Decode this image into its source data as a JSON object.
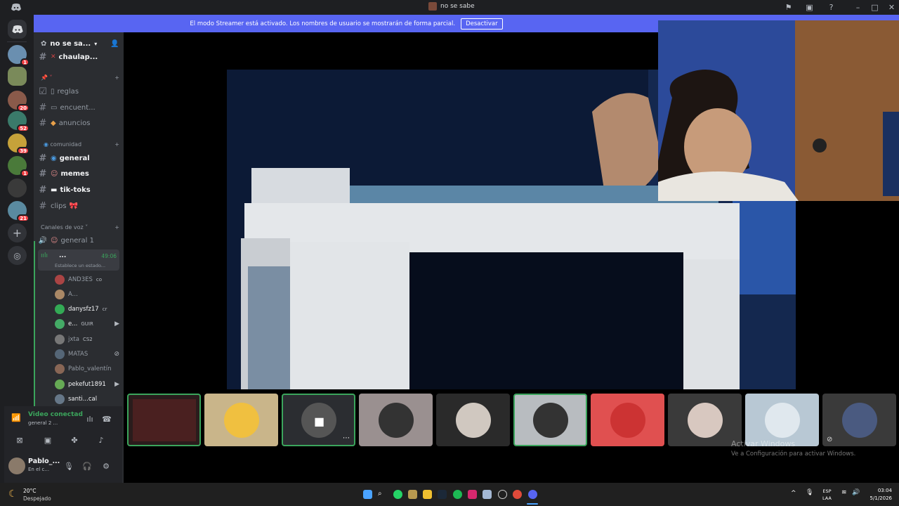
{
  "window": {
    "title": "no se sabe"
  },
  "banner": {
    "text": "El modo Streamer está activado. Los nombres de usuario se mostrarán de forma parcial.",
    "button": "Desactivar"
  },
  "guilds": [
    {
      "badge": "1"
    },
    {
      "badge": ""
    },
    {
      "badge": "20"
    },
    {
      "badge": "52"
    },
    {
      "badge": "39"
    },
    {
      "badge": "1"
    },
    {
      "badge": ""
    },
    {
      "badge": "21"
    }
  ],
  "server": {
    "name": "no se sa..."
  },
  "channels": {
    "top": "chaulap...",
    "pinned_category": "",
    "reglas": "reglas",
    "encuentros": "encuent...",
    "anuncios": "anuncios",
    "comunidad_category": "comunidad",
    "general": "general",
    "memes": "memes",
    "tiktoks": "tik-toks",
    "clips": "clips"
  },
  "voice": {
    "category": "Canales de voz",
    "general1": "general 1",
    "current_channel": "...",
    "current_time": "49:06",
    "status": "Establece un estado...",
    "users": [
      {
        "name": "AND3ES",
        "tag": "co"
      },
      {
        "name": "A...",
        "tag": ""
      },
      {
        "name": "danysfz17",
        "tag": "cr"
      },
      {
        "name": "e...",
        "tag": "GUIR"
      },
      {
        "name": "jxta",
        "tag": "CS2"
      },
      {
        "name": "MATAS",
        "tag": ""
      },
      {
        "name": "Pablo_valentín",
        "tag": ""
      },
      {
        "name": "pekefut1891",
        "tag": ""
      },
      {
        "name": "santi...cal",
        "tag": ""
      }
    ]
  },
  "voice_panel": {
    "status": "Video conectad",
    "channel": "general 2 ..."
  },
  "user_panel": {
    "name": "Pablo_...",
    "status": "En el c..."
  },
  "watermark": {
    "line1": "Activar Windows",
    "line2": "Ve a Configuración para activar Windows."
  },
  "weather": {
    "temp": "20°C",
    "desc": "Despejado"
  },
  "tray": {
    "lang1": "ESP",
    "lang2": "LAA",
    "time": "03:04",
    "date": "5/1/2026"
  },
  "colors": {
    "blurple": "#5865f2",
    "green": "#3ba55c",
    "sidebar": "#2b2d31",
    "guilds": "#1e1f22"
  }
}
